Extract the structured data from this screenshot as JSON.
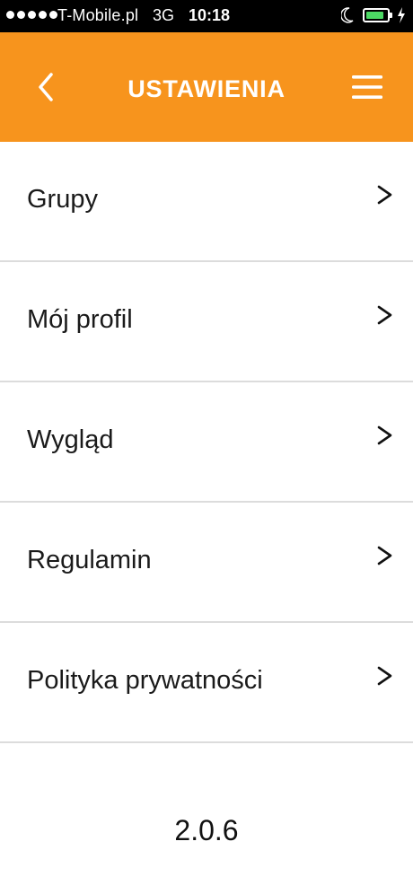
{
  "status_bar": {
    "carrier": "T-Mobile.pl",
    "network": "3G",
    "time": "10:18",
    "signal_bars": 5,
    "battery_level": 0.85,
    "battery_color": "#4cd964"
  },
  "header": {
    "title": "USTAWIENIA",
    "back_icon": "chevron-left-icon",
    "menu_icon": "hamburger-menu-icon",
    "background_color": "#f7941d"
  },
  "settings": {
    "items": [
      {
        "label": "Grupy"
      },
      {
        "label": "Mój profil"
      },
      {
        "label": "Wygląd"
      },
      {
        "label": "Regulamin"
      },
      {
        "label": "Polityka prywatności"
      }
    ]
  },
  "footer": {
    "version": "2.0.6"
  }
}
